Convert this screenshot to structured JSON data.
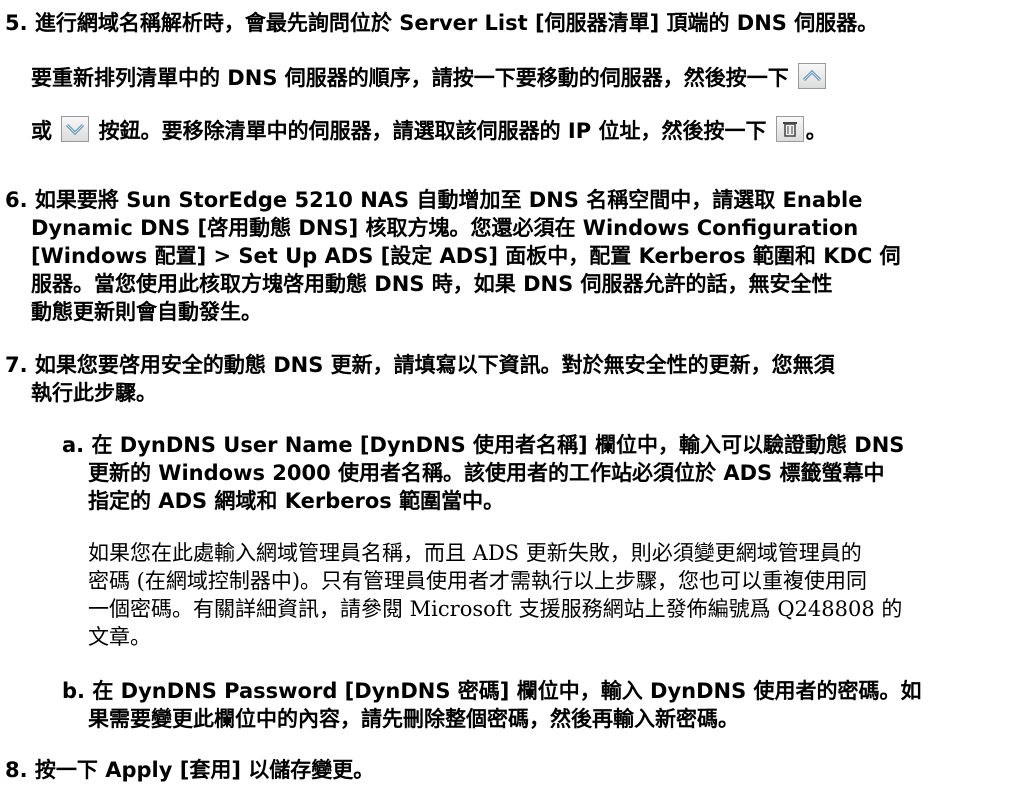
{
  "steps": {
    "s5": {
      "num": "5.",
      "l1": "進行網域名稱解析時，會最先詢問位於 Server List [伺服器清單] 頂端的 DNS 伺服器。",
      "l2": "要重新排列清單中的 DNS 伺服器的順序，請按一下要移動的伺服器，然後按一下",
      "l3a": "或",
      "l3b": "按鈕。要移除清單中的伺服器，請選取該伺服器的 IP 位址，然後按一下",
      "l3c": "。"
    },
    "s6": {
      "num": "6.",
      "l1": "如果要將 Sun StorEdge 5210 NAS 自動增加至 DNS 名稱空間中，請選取 Enable",
      "l2": "Dynamic DNS [啓用動態 DNS] 核取方塊。您還必須在 Windows Configuration",
      "l3": "[Windows 配置] > Set Up ADS [設定 ADS] 面板中，配置 Kerberos 範圍和 KDC 伺",
      "l4": "服器。當您使用此核取方塊啓用動態 DNS 時，如果 DNS 伺服器允許的話，無安全性",
      "l5": "動態更新則會自動發生。"
    },
    "s7": {
      "num": "7.",
      "l1": "如果您要啓用安全的動態 DNS 更新，請填寫以下資訊。對於無安全性的更新，您無須",
      "l2": "執行此步驟。",
      "a": {
        "label": "a.",
        "l1": "在 DynDNS User Name [DynDNS 使用者名稱] 欄位中，輸入可以驗證動態 DNS",
        "l2": "更新的 Windows 2000 使用者名稱。該使用者的工作站必須位於 ADS 標籤螢幕中",
        "l3": "指定的 ADS 網域和 Kerberos 範圍當中。",
        "p1": "如果您在此處輸入網域管理員名稱，而且 ADS 更新失敗，則必須變更網域管理員的",
        "p2": "密碼 (在網域控制器中)。只有管理員使用者才需執行以上步驟，您也可以重複使用同",
        "p3": "一個密碼。有關詳細資訊，請參閱 Microsoft 支援服務網站上發佈編號爲 Q248808 的",
        "p4": "文章。"
      },
      "b": {
        "label": "b.",
        "l1": "在 DynDNS Password [DynDNS 密碼] 欄位中，輸入 DynDNS 使用者的密碼。如",
        "l2": "果需要變更此欄位中的內容，請先刪除整個密碼，然後再輸入新密碼。"
      }
    },
    "s8": {
      "num": "8.",
      "l1": "按一下 Apply [套用] 以儲存變更。"
    }
  },
  "icons": {
    "up": "chevron-up-icon",
    "down": "chevron-down-icon",
    "trash": "trash-icon"
  },
  "colors": {
    "icon_stroke": "#5b8fb0",
    "icon_fill": "#cfe2ee"
  }
}
